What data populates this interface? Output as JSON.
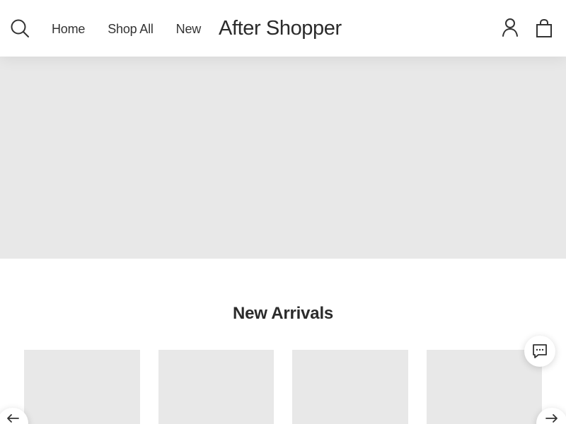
{
  "header": {
    "nav": [
      {
        "label": "Home"
      },
      {
        "label": "Shop All"
      },
      {
        "label": "New"
      }
    ],
    "brand": "After Shopper",
    "icons": {
      "search": "search-icon",
      "account": "user-icon",
      "cart": "shopping-bag-icon"
    }
  },
  "hero": {
    "background": "#e8e8e8"
  },
  "new_arrivals": {
    "title": "New Arrivals",
    "products": [
      {
        "image": "product-image-placeholder"
      },
      {
        "image": "product-image-placeholder"
      },
      {
        "image": "product-image-placeholder"
      },
      {
        "image": "product-image-placeholder"
      }
    ],
    "controls": {
      "previous": "arrow-left-icon",
      "next": "arrow-right-icon"
    }
  },
  "chat": {
    "icon": "chat-bubble-icon"
  },
  "colors": {
    "text": "#333333",
    "placeholder": "#e8e8e8",
    "background": "#ffffff"
  }
}
